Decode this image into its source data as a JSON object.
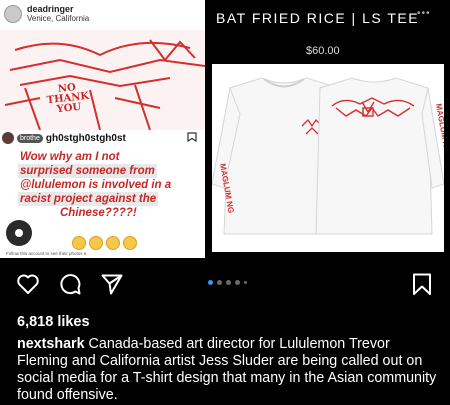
{
  "left_post": {
    "username": "deadringer",
    "location": "Venice, California",
    "box_text": [
      "NO",
      "THANK",
      "YOU"
    ],
    "comment_handle": "brothe",
    "comment_name": "gh0stgh0stgh0st",
    "comment_lines": [
      "Wow why am I not",
      "surprised someone from",
      "@lululemon is involved in a",
      "racist project against the",
      "Chinese????!"
    ],
    "footnote": "Follow this account to see their photos a"
  },
  "product": {
    "title": "BAT FRIED RICE | LS TEE",
    "price": "$60.00",
    "more_icon": "more-icon",
    "back_print": "ma'lum ng",
    "sleeve_left": "ng pa'lum",
    "sleeve_right": "ma'lum ng"
  },
  "post": {
    "likes": "6,818 likes",
    "author": "nextshark",
    "caption": "Canada-based art director for Lululemon Trevor Fleming and California artist Jess Sluder are being called out on social media for a T-shirt design that many in the Asian community found offensive.",
    "carousel": {
      "count": 5,
      "active": 0
    },
    "accent": "#3897f0"
  }
}
